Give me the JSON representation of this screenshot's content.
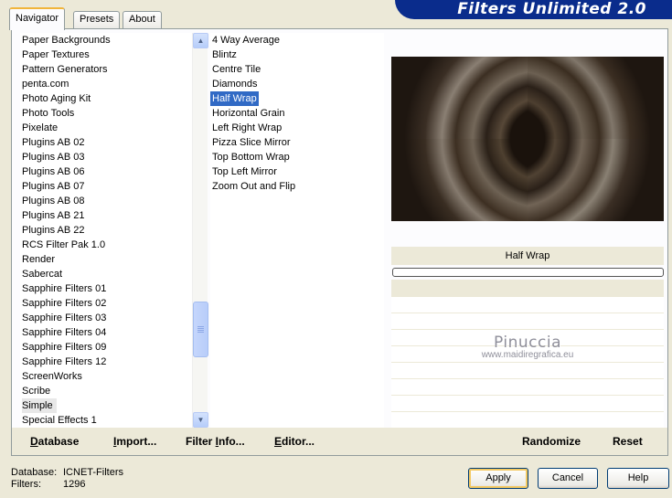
{
  "tabs": [
    {
      "label": "Navigator",
      "active": true
    },
    {
      "label": "Presets",
      "active": false
    },
    {
      "label": "About",
      "active": false
    }
  ],
  "banner": {
    "title": "Filters Unlimited 2.0"
  },
  "categories": {
    "items": [
      "Paper Backgrounds",
      "Paper Textures",
      "Pattern Generators",
      "penta.com",
      "Photo Aging Kit",
      "Photo Tools",
      "Pixelate",
      "Plugins AB 02",
      "Plugins AB 03",
      "Plugins AB 06",
      "Plugins AB 07",
      "Plugins AB 08",
      "Plugins AB 21",
      "Plugins AB 22",
      "RCS Filter Pak 1.0",
      "Render",
      "Sabercat",
      "Sapphire Filters 01",
      "Sapphire Filters 02",
      "Sapphire Filters 03",
      "Sapphire Filters 04",
      "Sapphire Filters 09",
      "Sapphire Filters 12",
      "ScreenWorks",
      "Scribe",
      "Simple",
      "Special Effects 1"
    ],
    "selected": "Simple",
    "scroll_position": 0.72
  },
  "filters": {
    "items": [
      "4 Way Average",
      "Blintz",
      "Centre Tile",
      "Diamonds",
      "Half Wrap",
      "Horizontal Grain",
      "Left Right Wrap",
      "Pizza Slice Mirror",
      "Top Bottom Wrap",
      "Top Left Mirror",
      "Zoom Out and Flip"
    ],
    "selected": "Half Wrap"
  },
  "preview": {
    "filter_name": "Half Wrap",
    "progress": 0
  },
  "watermark": {
    "title": "Pinuccia",
    "url": "www.maidiregrafica.eu"
  },
  "bottom_bar": {
    "database": {
      "label": "Database",
      "mnemonic": "D",
      "rest": "atabase"
    },
    "import": {
      "label": "Import...",
      "mnemonic": "I",
      "rest": "mport..."
    },
    "filter_info": {
      "label": "Filter Info...",
      "before": "Filter ",
      "mnemonic": "I",
      "rest": "nfo..."
    },
    "editor": {
      "label": "Editor...",
      "mnemonic": "E",
      "rest": "ditor..."
    },
    "randomize": "Randomize",
    "reset": "Reset"
  },
  "status": {
    "database_label": "Database:",
    "database_value": "ICNET-Filters",
    "filters_label": "Filters:",
    "filters_value": "1296"
  },
  "buttons": {
    "apply": "Apply",
    "cancel": "Cancel",
    "help": "Help"
  },
  "colors": {
    "banner": "#0a2c8c",
    "selection": "#316ac5",
    "dialog_bg": "#ece9d8"
  }
}
